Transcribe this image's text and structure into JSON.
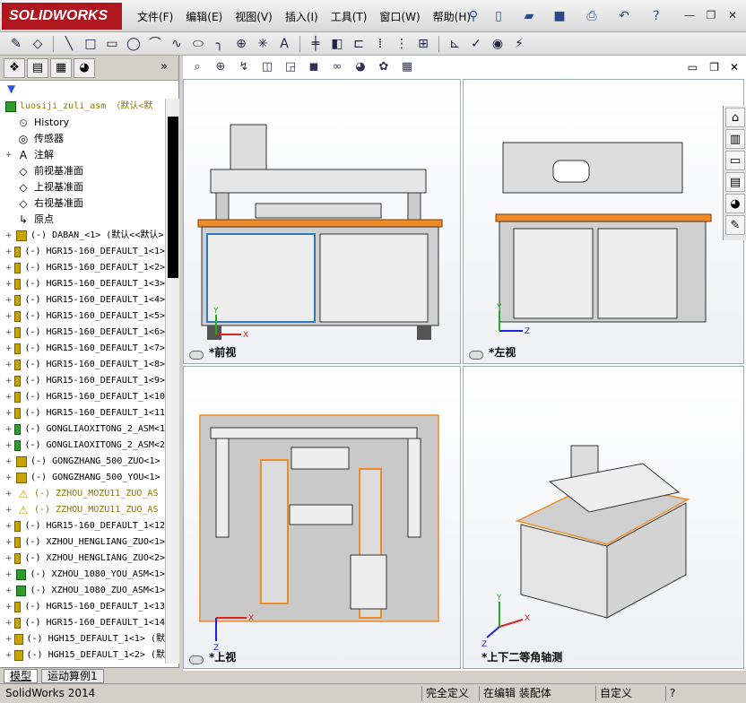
{
  "app": {
    "logo": "SOLIDWORKS"
  },
  "menu": [
    "文件(F)",
    "编辑(E)",
    "视图(V)",
    "插入(I)",
    "工具(T)",
    "窗口(W)",
    "帮助(H)"
  ],
  "tree": {
    "root": "luosiji_zuli_asm （默认<默",
    "items": [
      {
        "label": "History",
        "icon": "history-icon",
        "mono": false,
        "exp": ""
      },
      {
        "label": "传感器",
        "icon": "sensor-icon",
        "mono": false,
        "exp": ""
      },
      {
        "label": "注解",
        "icon": "annotation-icon",
        "mono": false,
        "exp": "+"
      },
      {
        "label": "前视基准面",
        "icon": "plane-icon",
        "mono": false,
        "exp": ""
      },
      {
        "label": "上视基准面",
        "icon": "plane-icon",
        "mono": false,
        "exp": ""
      },
      {
        "label": "右视基准面",
        "icon": "plane-icon",
        "mono": false,
        "exp": ""
      },
      {
        "label": "原点",
        "icon": "origin-icon",
        "mono": false,
        "exp": ""
      },
      {
        "label": "(-) DABAN_<1> (默认<<默认>",
        "icon": "part-icon",
        "mono": true,
        "exp": "+"
      },
      {
        "label": "(-) HGR15-160_DEFAULT_1<1>",
        "icon": "part-icon",
        "mono": true,
        "exp": "+"
      },
      {
        "label": "(-) HGR15-160_DEFAULT_1<2>",
        "icon": "part-icon",
        "mono": true,
        "exp": "+"
      },
      {
        "label": "(-) HGR15-160_DEFAULT_1<3>",
        "icon": "part-icon",
        "mono": true,
        "exp": "+"
      },
      {
        "label": "(-) HGR15-160_DEFAULT_1<4>",
        "icon": "part-icon",
        "mono": true,
        "exp": "+"
      },
      {
        "label": "(-) HGR15-160_DEFAULT_1<5>",
        "icon": "part-icon",
        "mono": true,
        "exp": "+"
      },
      {
        "label": "(-) HGR15-160_DEFAULT_1<6>",
        "icon": "part-icon",
        "mono": true,
        "exp": "+"
      },
      {
        "label": "(-) HGR15-160_DEFAULT_1<7>",
        "icon": "part-icon",
        "mono": true,
        "exp": "+"
      },
      {
        "label": "(-) HGR15-160_DEFAULT_1<8>",
        "icon": "part-icon",
        "mono": true,
        "exp": "+"
      },
      {
        "label": "(-) HGR15-160_DEFAULT_1<9>",
        "icon": "part-icon",
        "mono": true,
        "exp": "+"
      },
      {
        "label": "(-) HGR15-160_DEFAULT_1<10",
        "icon": "part-icon",
        "mono": true,
        "exp": "+"
      },
      {
        "label": "(-) HGR15-160_DEFAULT_1<11",
        "icon": "part-icon",
        "mono": true,
        "exp": "+"
      },
      {
        "label": "(-) GONGLIAOXITONG_2_ASM<1",
        "icon": "asm-icon",
        "mono": true,
        "exp": "+"
      },
      {
        "label": "(-) GONGLIAOXITONG_2_ASM<2",
        "icon": "asm-icon",
        "mono": true,
        "exp": "+"
      },
      {
        "label": "(-) GONGZHANG_500_ZUO<1>",
        "icon": "part-icon",
        "mono": true,
        "exp": "+"
      },
      {
        "label": "(-) GONGZHANG_500_YOU<1>",
        "icon": "part-icon",
        "mono": true,
        "exp": "+"
      },
      {
        "label": "(-) ZZHOU_MOZU11_ZUO_AS",
        "icon": "warning-icon",
        "mono": true,
        "exp": "+",
        "warn": true
      },
      {
        "label": "(-) ZZHOU_MOZU11_ZUO_AS",
        "icon": "warning-icon",
        "mono": true,
        "exp": "+",
        "warn": true
      },
      {
        "label": "(-) HGR15-160_DEFAULT_1<12",
        "icon": "part-icon",
        "mono": true,
        "exp": "+"
      },
      {
        "label": "(-) XZHOU_HENGLIANG_ZUO<1>",
        "icon": "part-icon",
        "mono": true,
        "exp": "+"
      },
      {
        "label": "(-) XZHOU_HENGLIANG_ZUO<2>",
        "icon": "part-icon",
        "mono": true,
        "exp": "+"
      },
      {
        "label": "(-) XZHOU_1080_YOU_ASM<1>",
        "icon": "asm-icon",
        "mono": true,
        "exp": "+"
      },
      {
        "label": "(-) XZHOU_1080_ZUO_ASM<1>",
        "icon": "asm-icon",
        "mono": true,
        "exp": "+"
      },
      {
        "label": "(-) HGR15-160_DEFAULT_1<13",
        "icon": "part-icon",
        "mono": true,
        "exp": "+"
      },
      {
        "label": "(-) HGR15-160_DEFAULT_1<14",
        "icon": "part-icon",
        "mono": true,
        "exp": "+"
      },
      {
        "label": "(-) HGH15_DEFAULT_1<1> (默",
        "icon": "part-icon",
        "mono": true,
        "exp": "+"
      },
      {
        "label": "(-) HGH15_DEFAULT_1<2> (默",
        "icon": "part-icon",
        "mono": true,
        "exp": "+"
      }
    ]
  },
  "bottom_tabs": {
    "model": "模型",
    "motion": "运动算例1"
  },
  "views": {
    "front": "*前视",
    "left": "*左视",
    "top": "*上视",
    "iso": "*上下二等角轴测"
  },
  "axes": {
    "x": "X",
    "y": "Y",
    "z": "Z"
  },
  "status": {
    "app": "SolidWorks 2014",
    "defined": "完全定义",
    "editing": "在编辑 装配体",
    "custom": "自定义",
    "help": "?"
  },
  "colors": {
    "accent": "#f08c28",
    "frame": "#c9c9c9",
    "brand": "#b0161d"
  }
}
